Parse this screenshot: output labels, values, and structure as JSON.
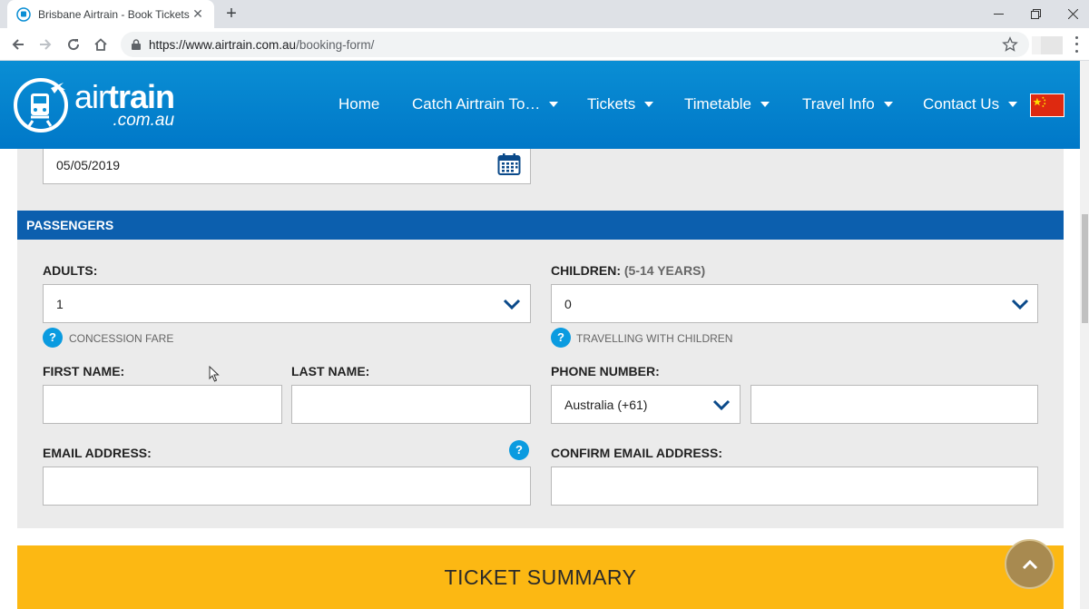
{
  "browser": {
    "tab_title": "Brisbane Airtrain - Book Tickets",
    "url_host": "https://www.airtrain.com.au",
    "url_path": "/booking-form/"
  },
  "site": {
    "logo_air": "air",
    "logo_train": "train",
    "logo_domain": ".com.au",
    "nav": [
      {
        "label": "Home",
        "has_caret": false
      },
      {
        "label": "Catch Airtrain To…",
        "has_caret": true
      },
      {
        "label": "Tickets",
        "has_caret": true
      },
      {
        "label": "Timetable",
        "has_caret": true
      },
      {
        "label": "Travel Info",
        "has_caret": true
      },
      {
        "label": "Contact Us",
        "has_caret": true
      }
    ],
    "language_flag": "china-flag-icon"
  },
  "form": {
    "date_value": "05/05/2019",
    "passengers_title": "PASSENGERS",
    "adults_label": "ADULTS:",
    "adults_value": "1",
    "adults_help": "CONCESSION FARE",
    "children_label": "CHILDREN:",
    "children_sublabel": "(5-14 YEARS)",
    "children_value": "0",
    "children_help": "TRAVELLING WITH CHILDREN",
    "first_name_label": "FIRST NAME:",
    "last_name_label": "LAST NAME:",
    "phone_label": "PHONE NUMBER:",
    "phone_country_value": "Australia (+61)",
    "email_label": "EMAIL ADDRESS:",
    "confirm_email_label": "CONFIRM EMAIL ADDRESS:",
    "help_glyph": "?"
  },
  "summary": {
    "title": "TICKET SUMMARY"
  },
  "colors": {
    "header_blue": "#0084cc",
    "section_blue": "#0c5fae",
    "summary_yellow": "#fcb813",
    "help_blue": "#0a9be0",
    "chevron_navy": "#0b4a8a"
  }
}
